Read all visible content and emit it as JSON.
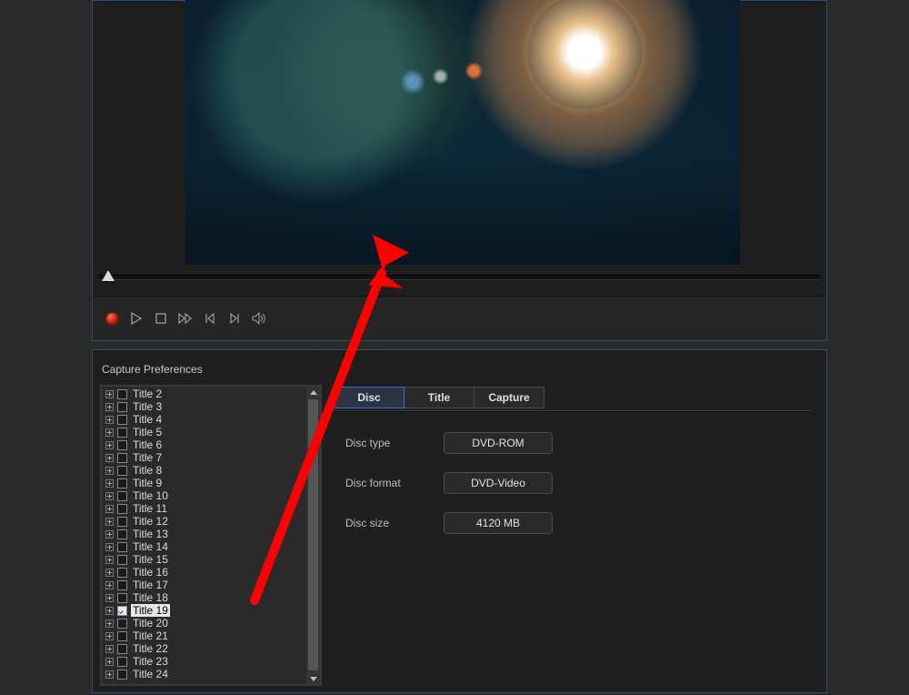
{
  "captureTitle": "Capture Preferences",
  "transport": {
    "icons": [
      "record",
      "play",
      "stop",
      "fast-forward",
      "step-back",
      "step-forward",
      "volume"
    ]
  },
  "titles": {
    "selectedIndex": 17,
    "items": [
      {
        "label": "Title 2",
        "checked": false
      },
      {
        "label": "Title 3",
        "checked": false
      },
      {
        "label": "Title 4",
        "checked": false
      },
      {
        "label": "Title 5",
        "checked": false
      },
      {
        "label": "Title 6",
        "checked": false
      },
      {
        "label": "Title 7",
        "checked": false
      },
      {
        "label": "Title 8",
        "checked": false
      },
      {
        "label": "Title 9",
        "checked": false
      },
      {
        "label": "Title 10",
        "checked": false
      },
      {
        "label": "Title 11",
        "checked": false
      },
      {
        "label": "Title 12",
        "checked": false
      },
      {
        "label": "Title 13",
        "checked": false
      },
      {
        "label": "Title 14",
        "checked": false
      },
      {
        "label": "Title 15",
        "checked": false
      },
      {
        "label": "Title 16",
        "checked": false
      },
      {
        "label": "Title 17",
        "checked": false
      },
      {
        "label": "Title 18",
        "checked": false
      },
      {
        "label": "Title 19",
        "checked": true
      },
      {
        "label": "Title 20",
        "checked": false
      },
      {
        "label": "Title 21",
        "checked": false
      },
      {
        "label": "Title 22",
        "checked": false
      },
      {
        "label": "Title 23",
        "checked": false
      },
      {
        "label": "Title 24",
        "checked": false
      }
    ]
  },
  "tabs": [
    {
      "id": "disc",
      "label": "Disc",
      "active": true
    },
    {
      "id": "title",
      "label": "Title",
      "active": false
    },
    {
      "id": "capture",
      "label": "Capture",
      "active": false
    }
  ],
  "disc": {
    "typeLabel": "Disc type",
    "typeValue": "DVD-ROM",
    "formatLabel": "Disc format",
    "formatValue": "DVD-Video",
    "sizeLabel": "Disc size",
    "sizeValue": "4120 MB"
  },
  "scrollbar": {
    "thumbTop": 14,
    "thumbHeight": 298
  }
}
